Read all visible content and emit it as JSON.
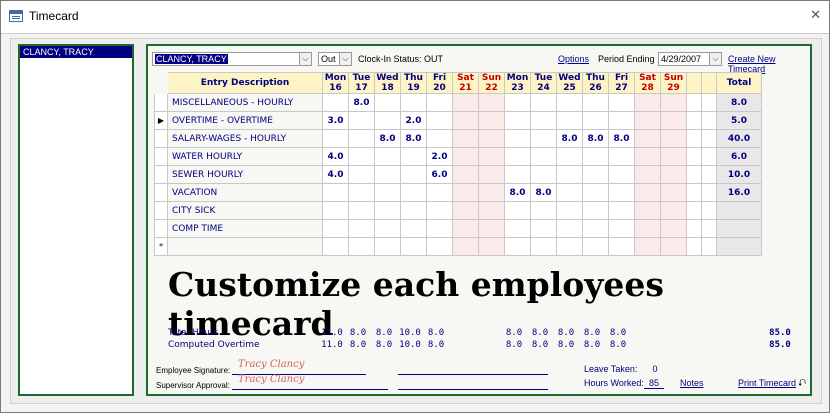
{
  "window": {
    "title": "Timecard",
    "close_glyph": "✕"
  },
  "employees": [
    "CLANCY, TRACY"
  ],
  "header": {
    "employee_value": "CLANCY, TRACY",
    "status_value": "Out",
    "clock_in_status": "Clock-In Status: OUT",
    "options_link": "Options",
    "period_label": "Period Ending",
    "period_value": "4/29/2007",
    "create_link": "Create New Timecard"
  },
  "grid": {
    "desc_header": "Entry Description",
    "total_header": "Total",
    "days": [
      {
        "d": "Mon",
        "n": "16",
        "we": false
      },
      {
        "d": "Tue",
        "n": "17",
        "we": false
      },
      {
        "d": "Wed",
        "n": "18",
        "we": false
      },
      {
        "d": "Thu",
        "n": "19",
        "we": false
      },
      {
        "d": "Fri",
        "n": "20",
        "we": false
      },
      {
        "d": "Sat",
        "n": "21",
        "we": true
      },
      {
        "d": "Sun",
        "n": "22",
        "we": true
      },
      {
        "d": "Mon",
        "n": "23",
        "we": false
      },
      {
        "d": "Tue",
        "n": "24",
        "we": false
      },
      {
        "d": "Wed",
        "n": "25",
        "we": false
      },
      {
        "d": "Thu",
        "n": "26",
        "we": false
      },
      {
        "d": "Fri",
        "n": "27",
        "we": false
      },
      {
        "d": "Sat",
        "n": "28",
        "we": true
      },
      {
        "d": "Sun",
        "n": "29",
        "we": true
      }
    ],
    "rows": [
      {
        "desc": "MISCELLANEOUS - HOURLY",
        "marker": "",
        "vals": [
          "",
          "8.0",
          "",
          "",
          "",
          "",
          "",
          "",
          "",
          "",
          "",
          "",
          "",
          ""
        ],
        "total": "8.0"
      },
      {
        "desc": "OVERTIME - OVERTIME",
        "marker": "▶",
        "vals": [
          "3.0",
          "",
          "",
          "2.0",
          "",
          "",
          "",
          "",
          "",
          "",
          "",
          "",
          "",
          ""
        ],
        "total": "5.0"
      },
      {
        "desc": "SALARY-WAGES - HOURLY",
        "marker": "",
        "vals": [
          "",
          "",
          "8.0",
          "8.0",
          "",
          "",
          "",
          "",
          "",
          "8.0",
          "8.0",
          "8.0",
          "",
          ""
        ],
        "total": "40.0"
      },
      {
        "desc": "WATER HOURLY",
        "marker": "",
        "vals": [
          "4.0",
          "",
          "",
          "",
          "2.0",
          "",
          "",
          "",
          "",
          "",
          "",
          "",
          "",
          ""
        ],
        "total": "6.0"
      },
      {
        "desc": "SEWER HOURLY",
        "marker": "",
        "vals": [
          "4.0",
          "",
          "",
          "",
          "6.0",
          "",
          "",
          "",
          "",
          "",
          "",
          "",
          "",
          ""
        ],
        "total": "10.0"
      },
      {
        "desc": "VACATION",
        "marker": "",
        "vals": [
          "",
          "",
          "",
          "",
          "",
          "",
          "",
          "8.0",
          "8.0",
          "",
          "",
          "",
          "",
          ""
        ],
        "total": "16.0"
      },
      {
        "desc": "CITY SICK",
        "marker": "",
        "vals": [
          "",
          "",
          "",
          "",
          "",
          "",
          "",
          "",
          "",
          "",
          "",
          "",
          "",
          ""
        ],
        "total": ""
      },
      {
        "desc": "COMP TIME",
        "marker": "",
        "vals": [
          "",
          "",
          "",
          "",
          "",
          "",
          "",
          "",
          "",
          "",
          "",
          "",
          "",
          ""
        ],
        "total": ""
      },
      {
        "desc": "",
        "marker": "*",
        "vals": [
          "",
          "",
          "",
          "",
          "",
          "",
          "",
          "",
          "",
          "",
          "",
          "",
          "",
          ""
        ],
        "total": ""
      }
    ]
  },
  "banner": "Customize each employees timecard",
  "summary": {
    "total_hours_label": "Total Hours",
    "total_hours": [
      "11.0",
      "8.0",
      "8.0",
      "10.0",
      "8.0",
      "",
      "",
      "8.0",
      "8.0",
      "8.0",
      "8.0",
      "8.0",
      "",
      ""
    ],
    "total_hours_sum": "85.0",
    "computed_ot_label": "Computed Overtime",
    "computed_ot": [
      "11.0",
      "8.0",
      "8.0",
      "10.0",
      "8.0",
      "",
      "",
      "8.0",
      "8.0",
      "8.0",
      "8.0",
      "8.0",
      "",
      ""
    ],
    "computed_ot_sum": "85.0"
  },
  "footer": {
    "emp_sig_label": "Employee Signature:",
    "emp_sig": "Tracy Clancy",
    "sup_label": "Supervisor Approval:",
    "sup_sig": "Tracy Clancy",
    "leave_label": "Leave Taken:",
    "leave_value": "0",
    "hours_label": "Hours Worked:",
    "hours_value": "85",
    "notes_link": "Notes",
    "print_link": "Print Timecard",
    "print_glyph": "⮏"
  },
  "colors": {
    "accent_green": "#1d6b2a",
    "header_yellow": "#fdf3c4",
    "weekend_red": "#c00000",
    "text_navy": "#000080",
    "selection": "#000080"
  }
}
